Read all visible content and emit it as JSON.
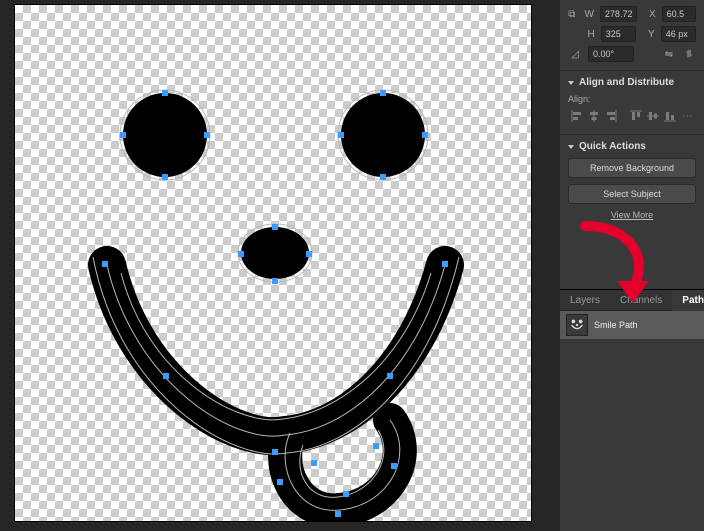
{
  "transform": {
    "w_label": "W",
    "w_value": "278.72 px",
    "x_label": "X",
    "x_value": "60.5 px",
    "h_label": "H",
    "h_value": "325 px",
    "y_label": "Y",
    "y_value": "46 px",
    "angle_label": "⊿",
    "angle_value": "0.00°"
  },
  "align": {
    "section_title": "Align and Distribute",
    "sublabel": "Align:"
  },
  "quick": {
    "section_title": "Quick Actions",
    "remove_bg": "Remove Background",
    "select_subject": "Select Subject",
    "view_more": "View More"
  },
  "tabs": {
    "layers": "Layers",
    "channels": "Channels",
    "paths": "Paths"
  },
  "paths": {
    "items": [
      {
        "name": "Smile Path"
      }
    ]
  }
}
